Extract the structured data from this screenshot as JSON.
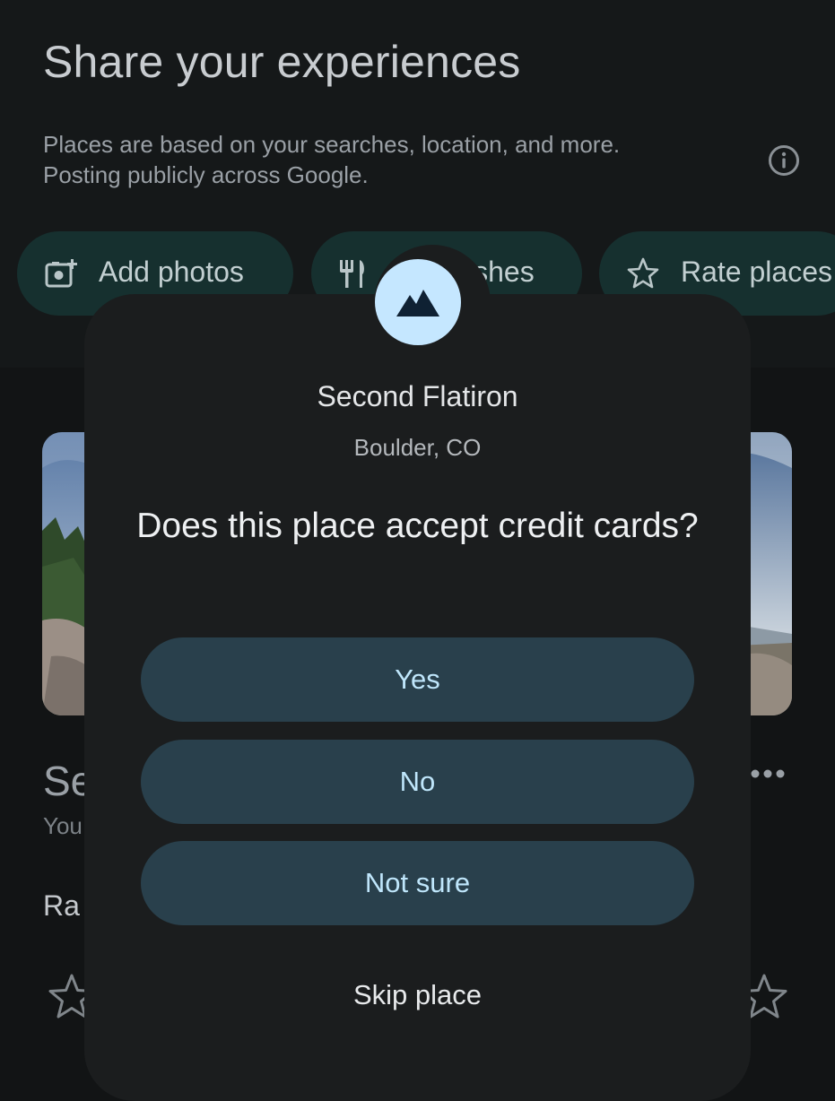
{
  "header": {
    "title": "Share your experiences",
    "description": "Places are based on your searches, location, and more. Posting publicly across Google.",
    "info_icon": "info-icon"
  },
  "chips": [
    {
      "label": "Add photos",
      "icon": "add-photo-icon"
    },
    {
      "label": "ishes",
      "icon": "restaurant-icon"
    },
    {
      "label": "Rate places",
      "icon": "star-outline-icon"
    }
  ],
  "background_card": {
    "title_fragment": "Se",
    "subtitle_fragment": "You",
    "rate_fragment": "Ra",
    "more_icon": "more-horizontal-icon"
  },
  "dialog": {
    "place_icon": "mountain-icon",
    "place_name": "Second Flatiron",
    "location": "Boulder, CO",
    "question": "Does this place accept credit cards?",
    "answers": [
      "Yes",
      "No",
      "Not sure"
    ],
    "skip_label": "Skip place"
  },
  "colors": {
    "background": "#121415",
    "dialog": "#1b1d1e",
    "answer_button": "#29404c",
    "answer_text": "#bfe6fb",
    "badge": "#c5e7ff",
    "chip": "#16302f"
  }
}
